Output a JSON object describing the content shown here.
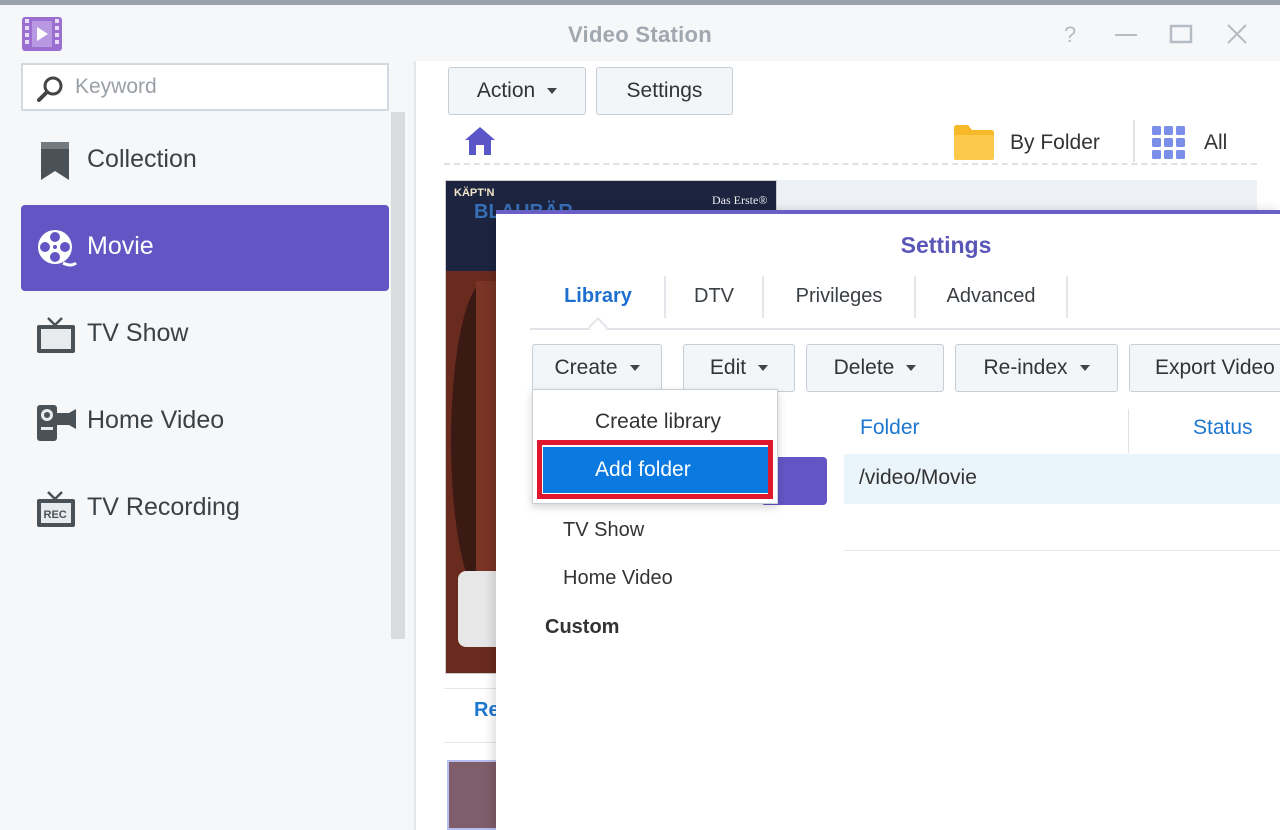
{
  "window": {
    "title": "Video Station",
    "help_glyph": "?",
    "minimize_glyph": "—",
    "maximize_glyph": "☐",
    "close_glyph": "✕"
  },
  "sidebar": {
    "search_placeholder": "Keyword",
    "items": [
      {
        "label": "Collection",
        "icon": "bookmark-icon",
        "active": false
      },
      {
        "label": "Movie",
        "icon": "film-reel-icon",
        "active": true
      },
      {
        "label": "TV Show",
        "icon": "tv-icon",
        "active": false
      },
      {
        "label": "Home Video",
        "icon": "camcorder-icon",
        "active": false
      },
      {
        "label": "TV Recording",
        "icon": "rec-tv-icon",
        "active": false
      }
    ]
  },
  "toolbar": {
    "action_label": "Action",
    "settings_label": "Settings",
    "view_by_label": "By Folder",
    "filter_label": "All"
  },
  "background": {
    "poster_logo_top": "KÄPT'N",
    "poster_logo_main": "BLAUBÄR",
    "poster_brand": "Das Erste®",
    "tab_fragment": "Re"
  },
  "dialog": {
    "title": "Settings",
    "tabs": [
      "Library",
      "DTV",
      "Privileges",
      "Advanced"
    ],
    "active_tab": "Library",
    "buttons": {
      "create": "Create",
      "edit": "Edit",
      "delete": "Delete",
      "reindex": "Re-index",
      "export": "Export Video"
    },
    "columns": {
      "folder": "Folder",
      "status": "Status"
    },
    "rows": [
      {
        "folder": "/video/Movie"
      }
    ],
    "libraries": {
      "tv_show": "TV Show",
      "home_video": "Home Video",
      "custom_heading": "Custom"
    }
  },
  "create_menu": {
    "items": [
      "Create library",
      "Add folder"
    ],
    "highlighted": "Add folder"
  },
  "colors": {
    "accent": "#6356c4",
    "link_blue": "#1e78d0",
    "menu_highlight": "#0a7ae0",
    "annotation_red": "#e0182d"
  }
}
